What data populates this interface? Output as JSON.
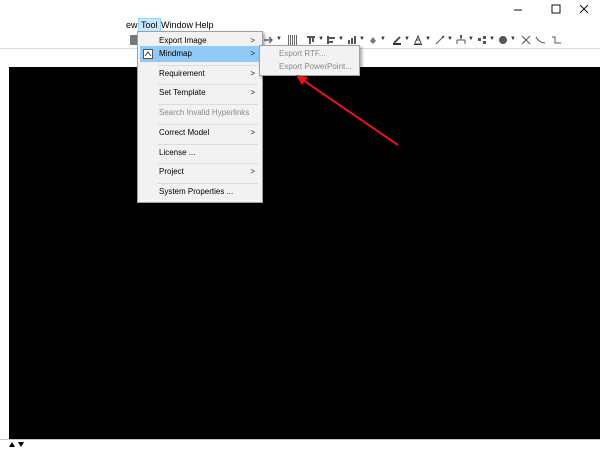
{
  "window": {
    "minimize_icon": "minimize-icon",
    "maximize_icon": "maximize-icon",
    "close_icon": "close-icon"
  },
  "menubar": {
    "items": [
      {
        "label": "ew"
      },
      {
        "label": "Tool"
      },
      {
        "label": "Window"
      },
      {
        "label": "Help"
      }
    ]
  },
  "tool_menu": {
    "items": [
      {
        "label": "Export Image",
        "submenu": true
      },
      {
        "label": "Mindmap",
        "submenu": true,
        "highlighted": true
      },
      {
        "label": "Requirement",
        "submenu": true
      },
      {
        "label": "Set Template",
        "submenu": true
      },
      {
        "label": "Search Invalid Hyperlinks",
        "disabled": true
      },
      {
        "label": "Correct Model",
        "submenu": true
      },
      {
        "label": "License ..."
      },
      {
        "label": "Project",
        "submenu": true
      },
      {
        "label": "System Properties ..."
      }
    ],
    "submenu_arrow": ">"
  },
  "mindmap_submenu": {
    "items": [
      {
        "label": "Export RTF...",
        "disabled": true
      },
      {
        "label": "Export PowerPoint...",
        "disabled": true
      }
    ]
  },
  "annotation": {
    "arrow_color": "#e8141b"
  },
  "colors": {
    "canvas": "#000000",
    "highlight": "#91c9f7",
    "menu_bg": "#f2f2f2"
  }
}
